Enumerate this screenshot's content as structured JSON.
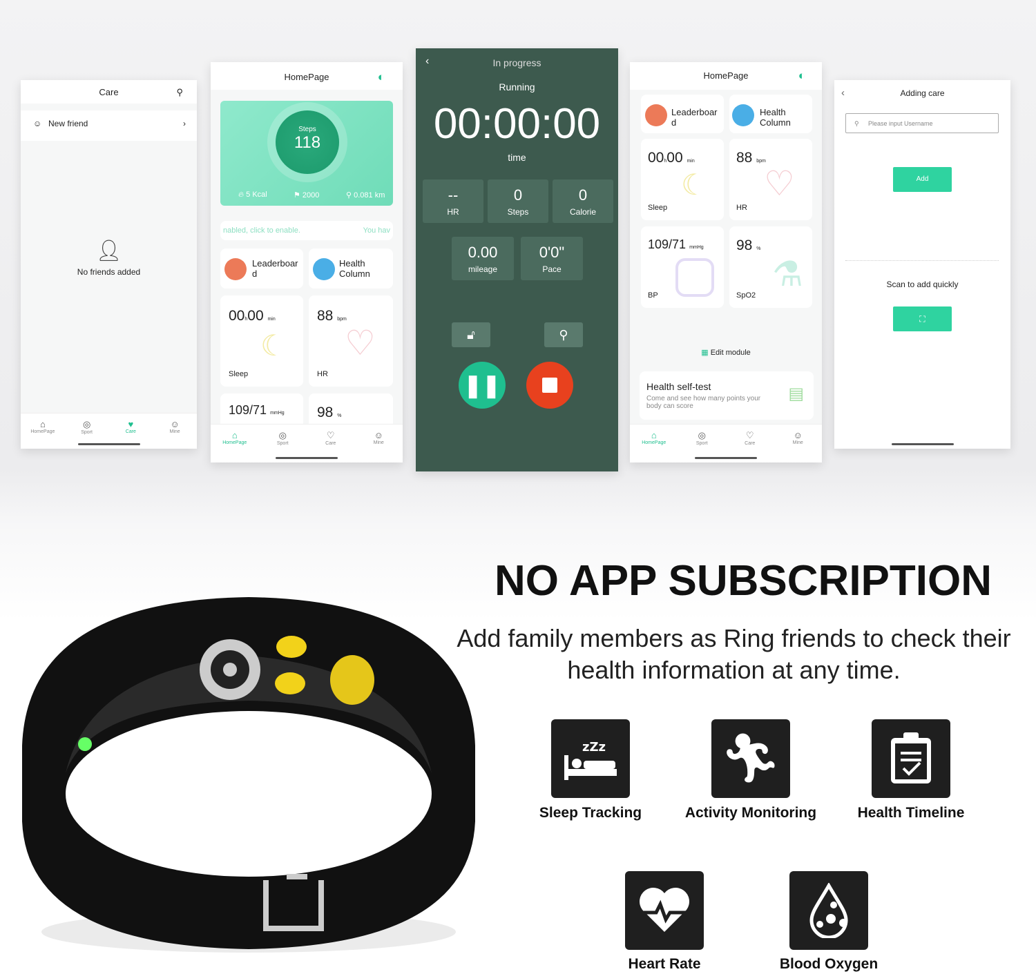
{
  "care": {
    "title": "Care",
    "new_friend": "New friend",
    "empty": "No friends added"
  },
  "nav": [
    "HomePage",
    "Sport",
    "Care",
    "Mine"
  ],
  "home": {
    "title": "HomePage",
    "steps_label": "Steps",
    "steps": "118",
    "kcal": "5 Kcal",
    "goal": "2000",
    "distance": "0.081 km",
    "banner_left": "nabled, click to enable.",
    "banner_right": "You hav",
    "leaderboard": "Leaderboar d",
    "health_column": "Health Column",
    "sleep_h": "00",
    "sleep_m": "00",
    "h_unit": "h",
    "min_unit": "min",
    "sleep": "Sleep",
    "hr_val": "88",
    "bpm": "bpm",
    "hr": "HR",
    "bp_val": "109/71",
    "mmhg": "mmHg",
    "bp": "BP",
    "spo2_val": "98",
    "pct": "%",
    "spo2": "SpO2",
    "edit_module": "Edit module",
    "selftest_title": "Health self-test",
    "selftest_desc": "Come and see how many points your body can score"
  },
  "run": {
    "status": "In progress",
    "mode": "Running",
    "timer": "00:00:00",
    "time_label": "time",
    "hr_val": "--",
    "hr": "HR",
    "steps_val": "0",
    "steps": "Steps",
    "cal_val": "0",
    "cal": "Calorie",
    "mileage_val": "0.00",
    "mileage": "mileage",
    "pace_val": "0'0\"",
    "pace": "Pace",
    "bg": "#3d5a4e",
    "pause_color": "#1fbf8f",
    "stop_color": "#e8411e"
  },
  "adding": {
    "title": "Adding care",
    "placeholder": "Please input Username",
    "add": "Add",
    "scan": "Scan to add quickly",
    "accent": "#2fd3a0"
  },
  "headline": "NO APP SUBSCRIPTION",
  "subtitle": "Add family members as Ring friends to check their health information at any time.",
  "features": [
    {
      "label": "Sleep Tracking",
      "icon": "sleep-icon"
    },
    {
      "label": "Activity Monitoring",
      "icon": "running-icon"
    },
    {
      "label": "Health Timeline",
      "icon": "clipboard-icon"
    },
    {
      "label": "Heart Rate",
      "icon": "heart-rate-icon"
    },
    {
      "label": "Blood Oxygen",
      "icon": "blood-oxygen-icon"
    }
  ]
}
